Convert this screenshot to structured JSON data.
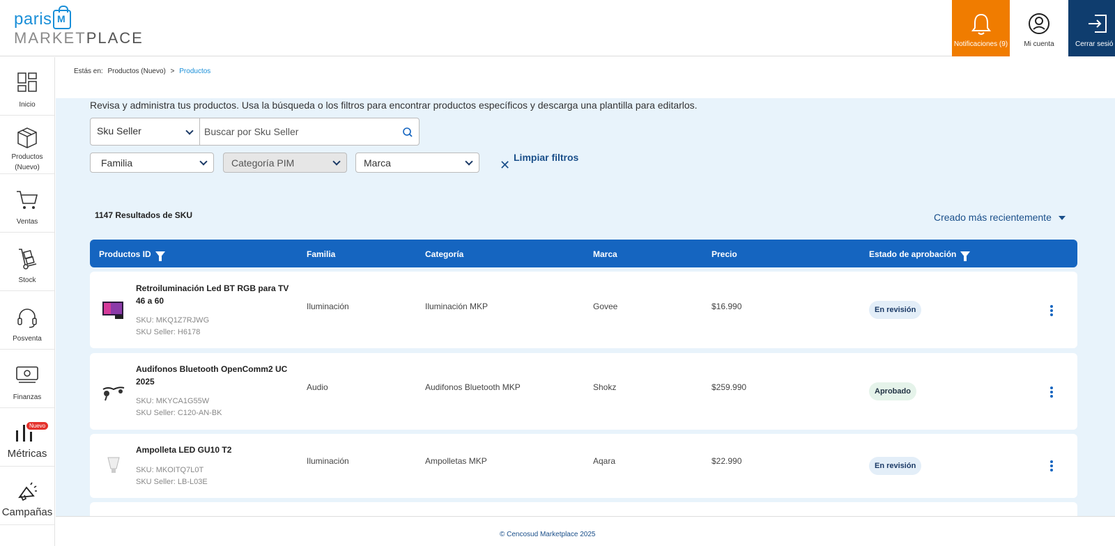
{
  "brand": {
    "top": "paris",
    "bag_letter": "M",
    "bottom_light": "MARKET",
    "bottom_dark": "PLACE"
  },
  "header": {
    "notifications_label": "Notificaciones (9)",
    "account_label": "Mi cuenta",
    "logout_label": "Cerrar sesió"
  },
  "sidebar": {
    "items": [
      {
        "label": "Inicio",
        "icon": "dashboard-icon"
      },
      {
        "label": "Productos (Nuevo)",
        "icon": "box-icon"
      },
      {
        "label": "Ventas",
        "icon": "cart-icon"
      },
      {
        "label": "Stock",
        "icon": "hand-truck-icon"
      },
      {
        "label": "Posventa",
        "icon": "headset-icon"
      },
      {
        "label": "Finanzas",
        "icon": "money-icon"
      },
      {
        "label": "Métricas",
        "icon": "bars-icon",
        "badge": "Nuevo"
      },
      {
        "label": "Campañas",
        "icon": "megaphone-icon"
      }
    ]
  },
  "breadcrumb": {
    "prefix": "Estás en:",
    "parent": "Productos (Nuevo)",
    "sep": ">",
    "current": "Productos"
  },
  "intro": "Revisa y administra tus productos. Usa la búsqueda o los filtros para encontrar productos específicos y descarga una plantilla para editarlos.",
  "search": {
    "type": "Sku Seller",
    "placeholder": "Buscar por Sku Seller"
  },
  "filters": {
    "familia": "Familia",
    "categoria": "Categoría PIM",
    "marca": "Marca",
    "clear": "Limpiar filtros"
  },
  "results": "1147 Resultados de SKU",
  "sort": "Creado más recientemente",
  "table": {
    "headers": {
      "id": "Productos ID",
      "familia": "Familia",
      "categoria": "Categoría",
      "marca": "Marca",
      "precio": "Precio",
      "estado": "Estado de aprobación"
    },
    "rows": [
      {
        "name": "Retroiluminación Led BT RGB para TV 46 a 60",
        "sku": "SKU: MKQ1Z7RJWG",
        "sku_seller": "SKU Seller: H6178",
        "familia": "Iluminación",
        "categoria": "Iluminación MKP",
        "marca": "Govee",
        "precio": "$16.990",
        "estado": "En revisión"
      },
      {
        "name": "Audifonos Bluetooth OpenComm2 UC 2025",
        "sku": "SKU: MKYCA1G55W",
        "sku_seller": "SKU Seller: C120-AN-BK",
        "familia": "Audio",
        "categoria": "Audifonos Bluetooth MKP",
        "marca": "Shokz",
        "precio": "$259.990",
        "estado": "Aprobado"
      },
      {
        "name": "Ampolleta LED GU10 T2",
        "sku": "SKU: MKOITQ7L0T",
        "sku_seller": "SKU Seller: LB-L03E",
        "familia": "Iluminación",
        "categoria": "Ampolletas MKP",
        "marca": "Aqara",
        "precio": "$22.990",
        "estado": "En revisión"
      }
    ]
  },
  "footer": "© Cencosud Marketplace 2025",
  "colors": {
    "accent": "#1565c0",
    "notif": "#f07c00",
    "logout": "#0f3d6e",
    "bg_main": "#e8f3fb"
  }
}
